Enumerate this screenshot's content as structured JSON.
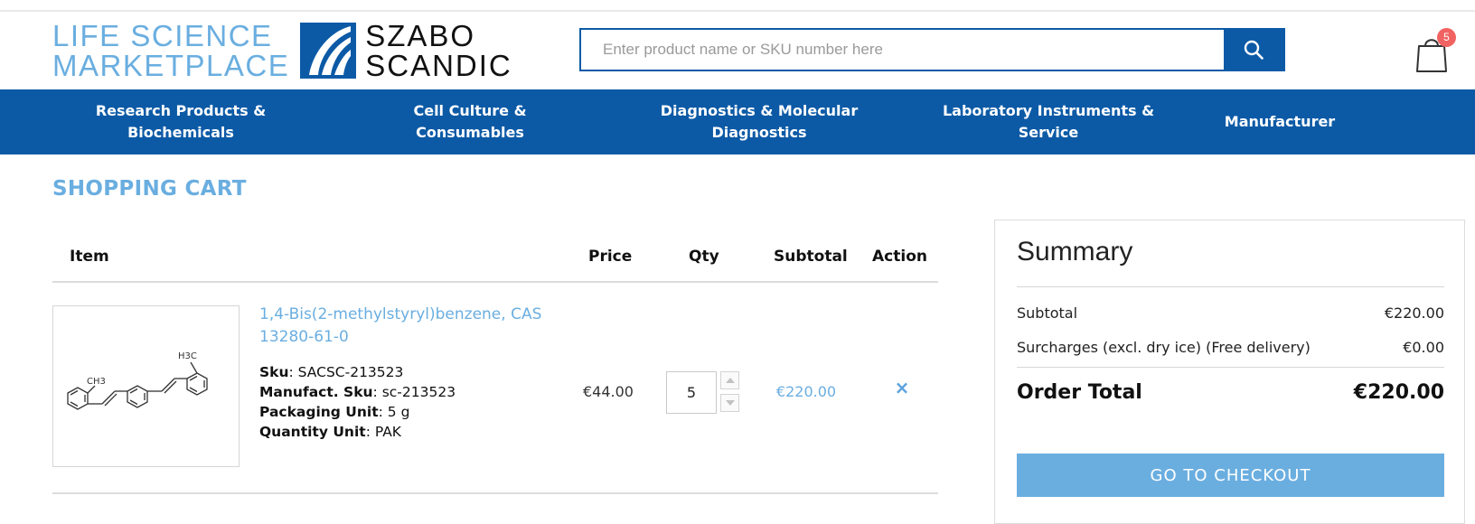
{
  "brand": {
    "left_line1": "LIFE SCIENCE",
    "left_line2": "MARKETPLACE",
    "right_line1": "SZABO",
    "right_line2": "SCANDIC"
  },
  "search": {
    "placeholder": "Enter product name or SKU number here",
    "value": "",
    "button_icon": "search-icon"
  },
  "cart": {
    "icon": "shopping-bag-icon",
    "count": "5"
  },
  "nav": {
    "items": [
      {
        "line1": "Research Products &",
        "line2": "Biochemicals"
      },
      {
        "line1": "Cell Culture & Consumables",
        "line2": ""
      },
      {
        "line1": "Diagnostics & Molecular",
        "line2": "Diagnostics"
      },
      {
        "line1": "Laboratory Instruments &",
        "line2": "Service"
      },
      {
        "line1": "Manufacturer",
        "line2": ""
      }
    ]
  },
  "page": {
    "title": "SHOPPING CART"
  },
  "table": {
    "headers": {
      "item": "Item",
      "price": "Price",
      "qty": "Qty",
      "subtotal": "Subtotal",
      "action": "Action"
    },
    "rows": [
      {
        "name_line1": "1,4-Bis(2-methylstyryl)benzene, CAS",
        "name_line2": "13280-61-0",
        "sku_label": "Sku",
        "sku": "SACSC-213523",
        "manufact_sku_label": "Manufact. Sku",
        "manufact_sku": "sc-213523",
        "packaging_label": "Packaging Unit",
        "packaging": "5 g",
        "quantity_unit_label": "Quantity Unit",
        "quantity_unit": "PAK",
        "price": "€44.00",
        "qty": "5",
        "subtotal": "€220.00",
        "remove_icon": "close-icon",
        "remove_glyph": "×",
        "structure_labels": {
          "methyl_left": "CH3",
          "methyl_right": "H3C"
        }
      }
    ]
  },
  "summary": {
    "title": "Summary",
    "rows": [
      {
        "label": "Subtotal",
        "value": "€220.00"
      },
      {
        "label": "Surcharges (excl. dry ice) (Free delivery)",
        "value": "€0.00"
      }
    ],
    "total_label": "Order Total",
    "total_value": "€220.00",
    "checkout_label": "GO TO CHECKOUT"
  },
  "colors": {
    "primary_blue": "#0c5aa6",
    "light_blue": "#6aaee0",
    "badge_red": "#f16362"
  }
}
